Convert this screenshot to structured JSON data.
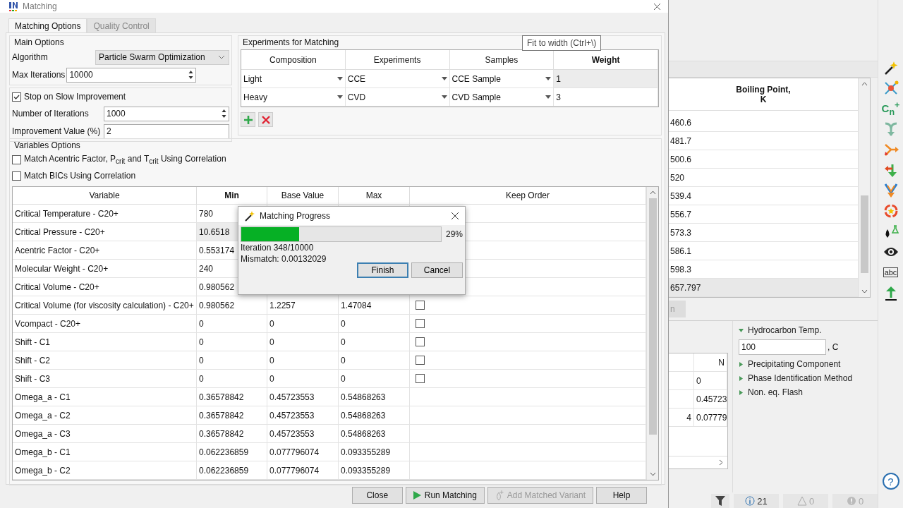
{
  "dialog": {
    "title": "Matching",
    "tabs": [
      {
        "label": "Matching Options",
        "selected": true
      },
      {
        "label": "Quality Control",
        "selected": false
      }
    ],
    "main_options": {
      "title": "Main Options",
      "algorithm": {
        "label": "Algorithm",
        "value": "Particle Swarm Optimization"
      },
      "max_iterations": {
        "label": "Max Iterations",
        "value": "10000"
      }
    },
    "slow_improvement": {
      "label": "Stop on Slow Improvement",
      "checked": true,
      "iterations": {
        "label": "Number of Iterations",
        "value": "1000"
      },
      "improvement": {
        "label": "Improvement Value (%)",
        "value": "2"
      }
    },
    "experiments": {
      "title": "Experiments for Matching",
      "columns": [
        {
          "label": "Composition",
          "selected": false
        },
        {
          "label": "Experiments",
          "selected": false
        },
        {
          "label": "Samples",
          "selected": false
        },
        {
          "label": "Weight",
          "selected": true
        }
      ],
      "rows": [
        {
          "composition": "Light",
          "experiment": "CCE",
          "sample": "CCE Sample",
          "weight": "1",
          "selected": true
        },
        {
          "composition": "Heavy",
          "experiment": "CVD",
          "sample": "CVD Sample",
          "weight": "3",
          "selected": false
        }
      ]
    },
    "variables_options": {
      "title": "Variables Options",
      "checkboxes": [
        {
          "label": "Match Acentric Factor, P$_{crit}$ and T$_{crit}$ Using Correlation",
          "checked": false
        },
        {
          "label": "Match BICs Using Correlation",
          "checked": false
        }
      ],
      "columns": [
        {
          "label": "Variable",
          "selected": false
        },
        {
          "label": "Min",
          "selected": true
        },
        {
          "label": "Base Value",
          "selected": false
        },
        {
          "label": "Max",
          "selected": false
        },
        {
          "label": "Keep Order",
          "selected": false
        }
      ],
      "rows": [
        {
          "variable": "Critical Temperature - C20+",
          "min": "780",
          "selected": false
        },
        {
          "variable": "Critical Pressure - C20+",
          "min": "10.6518",
          "selected": true
        },
        {
          "variable": "Acentric Factor - C20+",
          "min": "0.553174",
          "selected": false
        },
        {
          "variable": "Molecular Weight - C20+",
          "min": "240",
          "selected": false
        },
        {
          "variable": "Critical Volume - C20+",
          "min": "0.980562",
          "selected": false
        },
        {
          "variable": "Critical Volume (for viscosity calculation) - C20+",
          "min": "0.980562",
          "base": "1.2257",
          "max": "1.47084",
          "keep_order": false,
          "selected": false
        },
        {
          "variable": "Vcompact - C20+",
          "min": "0",
          "base": "0",
          "max": "0",
          "keep_order": false,
          "selected": false
        },
        {
          "variable": "Shift - C1",
          "min": "0",
          "base": "0",
          "max": "0",
          "keep_order": false,
          "selected": false
        },
        {
          "variable": "Shift - C2",
          "min": "0",
          "base": "0",
          "max": "0",
          "keep_order": false,
          "selected": false
        },
        {
          "variable": "Shift - C3",
          "min": "0",
          "base": "0",
          "max": "0",
          "keep_order": false,
          "selected": false
        },
        {
          "variable": "Omega_a - C1",
          "min": "0.36578842",
          "base": "0.45723553",
          "max": "0.54868263",
          "selected": false
        },
        {
          "variable": "Omega_a - C2",
          "min": "0.36578842",
          "base": "0.45723553",
          "max": "0.54868263",
          "selected": false
        },
        {
          "variable": "Omega_a - C3",
          "min": "0.36578842",
          "base": "0.45723553",
          "max": "0.54868263",
          "selected": false
        },
        {
          "variable": "Omega_b - C1",
          "min": "0.062236859",
          "base": "0.077796074",
          "max": "0.093355289",
          "selected": false
        },
        {
          "variable": "Omega_b - C2",
          "min": "0.062236859",
          "base": "0.077796074",
          "max": "0.093355289",
          "selected": false
        }
      ]
    },
    "buttons": [
      {
        "label": "Close",
        "kind": "plain",
        "disabled": false
      },
      {
        "label": "Run Matching",
        "kind": "play",
        "disabled": false
      },
      {
        "label": "Add Matched Variant",
        "kind": "drop",
        "disabled": true
      },
      {
        "label": "Help",
        "kind": "plain",
        "disabled": false
      }
    ]
  },
  "tooltip": {
    "text": "Fit to width (Ctrl+\\)"
  },
  "progress_dialog": {
    "title": "Matching Progress",
    "level": 0.29,
    "percent": "29%",
    "iteration": "Iteration 348/10000",
    "mismatch": "Mismatch: 0.00132029",
    "buttons": [
      {
        "label": "Finish",
        "default": true
      },
      {
        "label": "Cancel",
        "default": false
      }
    ]
  },
  "background_window": {
    "boiling_table": {
      "header": "Boiling Point,\nK",
      "rows": [
        {
          "value": "460.6",
          "selected": false
        },
        {
          "value": "481.7",
          "selected": false
        },
        {
          "value": "500.6",
          "selected": false
        },
        {
          "value": "520",
          "selected": false
        },
        {
          "value": "539.4",
          "selected": false
        },
        {
          "value": "556.7",
          "selected": false
        },
        {
          "value": "573.3",
          "selected": false
        },
        {
          "value": "586.1",
          "selected": false
        },
        {
          "value": "598.3",
          "selected": false
        },
        {
          "value": "657.797",
          "selected": true
        }
      ]
    },
    "cut_tab": {
      "label": "n"
    },
    "lower_table": {
      "header": "N",
      "rows": [
        {
          "column_2": "0"
        },
        {
          "column_2": "0.45723"
        },
        {
          "column_1": "4",
          "column_2": "0.07779"
        }
      ]
    },
    "properties": [
      {
        "label": "Hydrocarbon Temp.",
        "expanded": true,
        "value": "100",
        "unit": ", C"
      },
      {
        "label": "Precipitating Component",
        "expanded": false
      },
      {
        "label": "Phase Identification Method",
        "expanded": false
      },
      {
        "label": "Non. eq. Flash",
        "expanded": false
      }
    ],
    "toolbar": [
      {
        "kind": "wand"
      },
      {
        "kind": "molecule"
      },
      {
        "kind": "text",
        "text": "C$_{n}$$^{+}$"
      },
      {
        "kind": "merge"
      },
      {
        "kind": "split"
      },
      {
        "kind": "turn"
      },
      {
        "kind": "converge"
      },
      {
        "kind": "cycle"
      },
      {
        "kind": "drop-flask"
      },
      {
        "kind": "eye"
      },
      {
        "kind": "text",
        "text": "abc"
      },
      {
        "kind": "upload"
      }
    ],
    "help": {
      "label": "?"
    },
    "status": [
      {
        "kind": "filter"
      },
      {
        "kind": "info",
        "count": "21",
        "disabled": false
      },
      {
        "kind": "warning",
        "count": "0",
        "disabled": true
      },
      {
        "kind": "error",
        "count": "0",
        "disabled": true
      }
    ]
  }
}
